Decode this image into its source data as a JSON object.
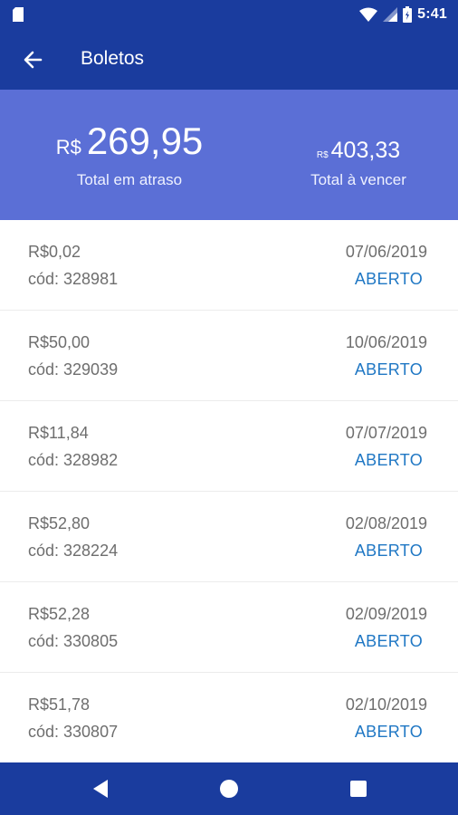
{
  "status_bar": {
    "time": "5:41"
  },
  "app_bar": {
    "title": "Boletos"
  },
  "summary": {
    "overdue": {
      "currency": "R$",
      "value": "269,95",
      "label": "Total em atraso"
    },
    "due": {
      "currency": "R$",
      "value": "403,33",
      "label": "Total à vencer"
    }
  },
  "boletos": [
    {
      "value": "R$0,02",
      "code": "cód: 328981",
      "date": "07/06/2019",
      "status": "ABERTO"
    },
    {
      "value": "R$50,00",
      "code": "cód: 329039",
      "date": "10/06/2019",
      "status": "ABERTO"
    },
    {
      "value": "R$11,84",
      "code": "cód: 328982",
      "date": "07/07/2019",
      "status": "ABERTO"
    },
    {
      "value": "R$52,80",
      "code": "cód: 328224",
      "date": "02/08/2019",
      "status": "ABERTO"
    },
    {
      "value": "R$52,28",
      "code": "cód: 330805",
      "date": "02/09/2019",
      "status": "ABERTO"
    },
    {
      "value": "R$51,78",
      "code": "cód: 330807",
      "date": "02/10/2019",
      "status": "ABERTO"
    }
  ],
  "icons": {
    "status": [
      "sim-card-icon",
      "wifi-icon",
      "signal-icon",
      "battery-icon"
    ],
    "app_bar": "arrow-back-icon",
    "nav": [
      "nav-back-icon",
      "nav-home-icon",
      "nav-recent-icon"
    ]
  },
  "colors": {
    "primary": "#1a3c9e",
    "summary_bg": "#5b6fd6",
    "status_open": "#1f77c4",
    "text_secondary": "#6e6e6e"
  }
}
